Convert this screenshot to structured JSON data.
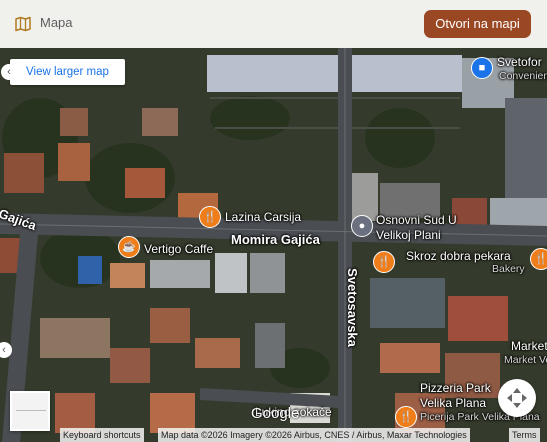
{
  "header": {
    "title": "Mapa",
    "open_button": "Otvori na mapi",
    "icon": "map-icon"
  },
  "map": {
    "view_larger": "View larger map",
    "google_logo": "Google",
    "streets": {
      "main": "Momira Gajića",
      "main_left": "Gajića",
      "vertical": "Svetosavska",
      "bottom": "Lukino sokače"
    },
    "places": {
      "lazina": "Lazina Carsija",
      "vertigo": "Vertigo Caffe",
      "osnovni_line1": "Osnovni Sud U",
      "osnovni_line2": "Velikoj Plani",
      "skroz": "Skroz dobra pekara",
      "skroz_sub": "Bakery",
      "svetofor": "Svetofor",
      "svetofor_sub": "Convenien",
      "market_line1": "Market V",
      "market_line2": "Market Ve",
      "pizzeria_line1": "Pizzeria Park",
      "pizzeria_line2": "Velika Plana",
      "pizzeria_line3": "Picerija Park Velika Plana"
    },
    "pin_icons": [
      "restaurant-icon",
      "cafe-icon",
      "landmark-icon",
      "store-icon"
    ]
  },
  "footer": {
    "shortcuts": "Keyboard shortcuts",
    "mapdata": "Map data ©2026 Imagery ©2026 Airbus, CNES / Airbus, Maxar Technologies",
    "terms": "Terms"
  },
  "colors": {
    "header_bg": "#f0f1ec",
    "button_bg": "#9a4724",
    "pin_orange": "#ef7d1a",
    "link_blue": "#1a73e8"
  }
}
